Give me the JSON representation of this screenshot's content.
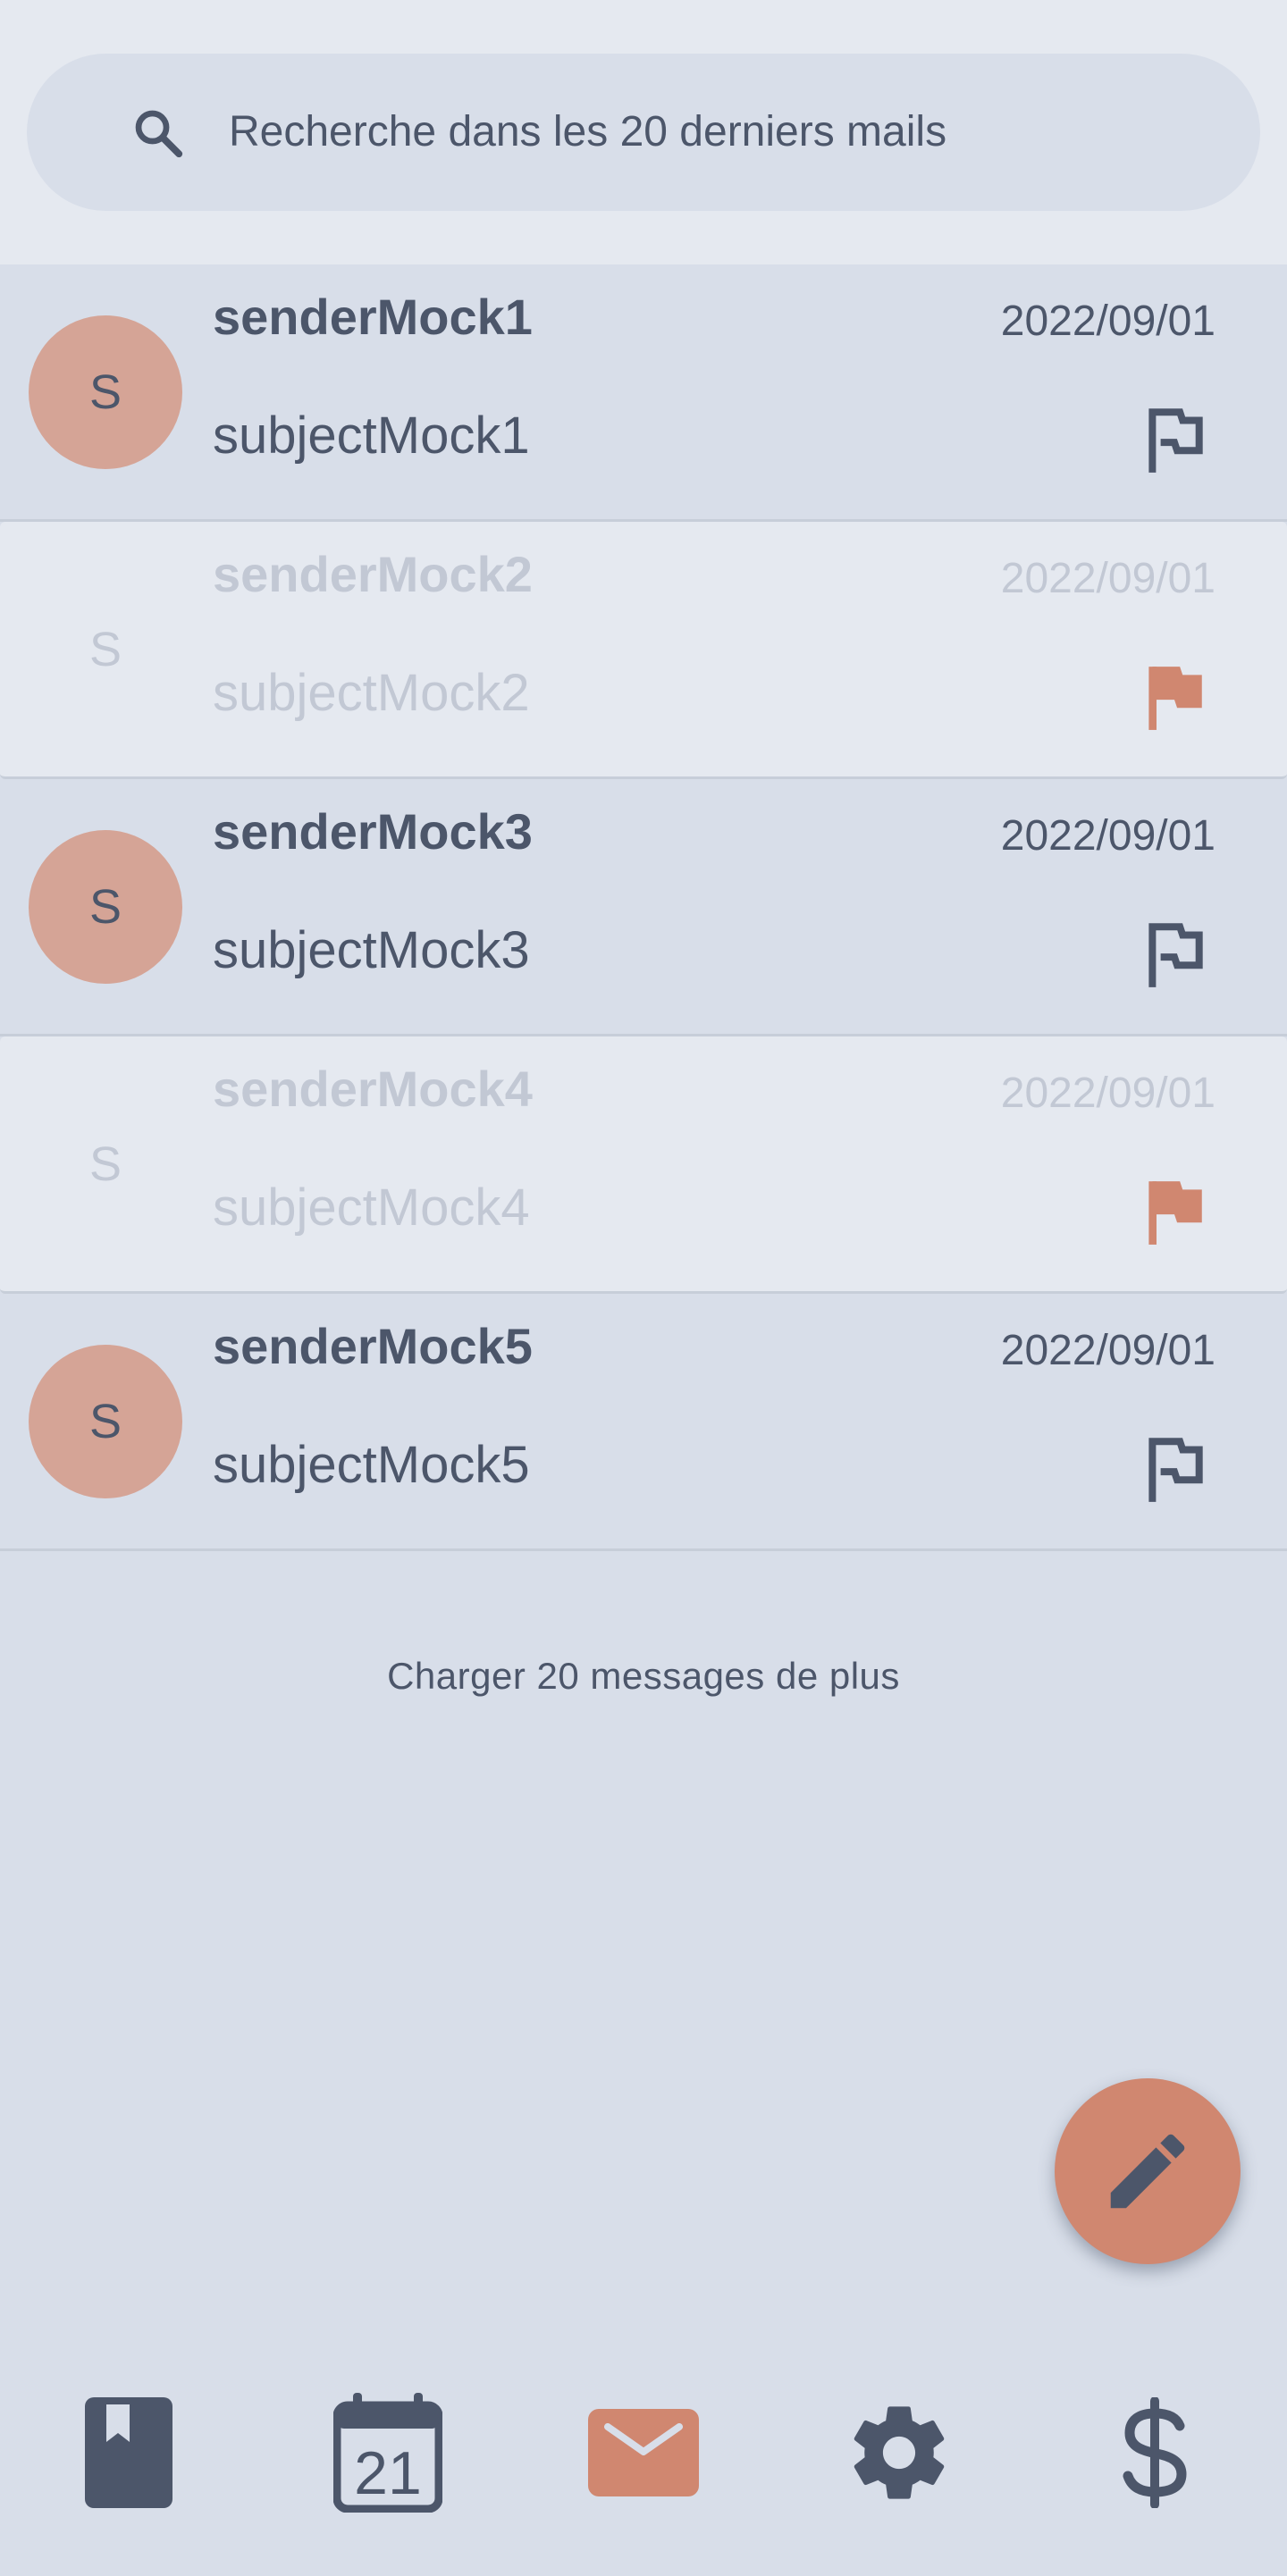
{
  "search": {
    "placeholder": "Recherche dans les 20 derniers mails",
    "icon": "search-icon"
  },
  "mails": [
    {
      "avatar": "S",
      "sender": "senderMock1",
      "date": "2022/09/01",
      "subject": "subjectMock1",
      "read": false,
      "flagged": false
    },
    {
      "avatar": "S",
      "sender": "senderMock2",
      "date": "2022/09/01",
      "subject": "subjectMock2",
      "read": true,
      "flagged": true
    },
    {
      "avatar": "S",
      "sender": "senderMock3",
      "date": "2022/09/01",
      "subject": "subjectMock3",
      "read": false,
      "flagged": false
    },
    {
      "avatar": "S",
      "sender": "senderMock4",
      "date": "2022/09/01",
      "subject": "subjectMock4",
      "read": true,
      "flagged": true
    },
    {
      "avatar": "S",
      "sender": "senderMock5",
      "date": "2022/09/01",
      "subject": "subjectMock5",
      "read": false,
      "flagged": false
    }
  ],
  "load_more_label": "Charger 20 messages de plus",
  "fab": {
    "icon": "pencil-icon"
  },
  "nav": {
    "items": [
      {
        "icon": "bookmark-book-icon",
        "active": false
      },
      {
        "icon": "calendar-icon",
        "label": "21",
        "active": false
      },
      {
        "icon": "mail-icon",
        "active": true
      },
      {
        "icon": "gear-icon",
        "active": false
      },
      {
        "icon": "dollar-icon",
        "active": false
      }
    ]
  },
  "colors": {
    "background": "#d8dee9",
    "surface": "#e5e9f0",
    "text": "#4c566a",
    "accent": "#d08770",
    "avatar": "#d5a496",
    "faded_text": "#c2c8d4"
  }
}
